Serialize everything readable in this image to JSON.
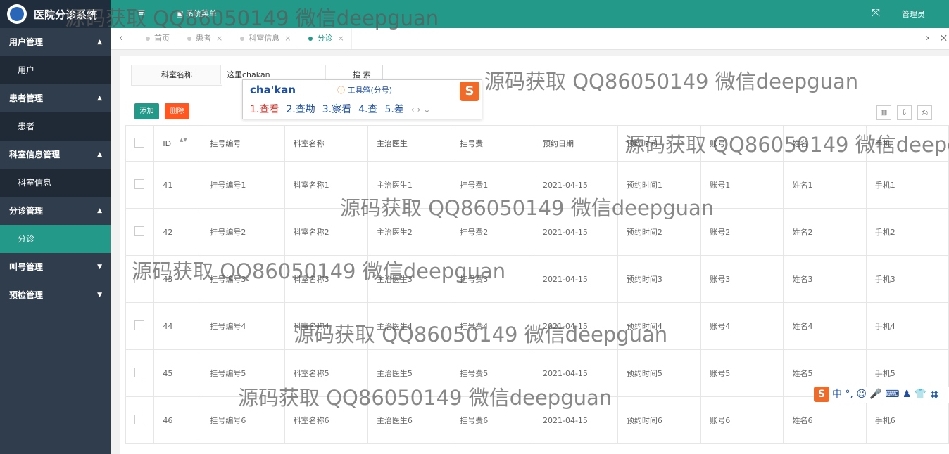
{
  "app": {
    "title": "医院分诊系统",
    "menu_icon": "≡",
    "top_tab": "▣ 系统菜单",
    "fullscreen_icon": "⤧",
    "user": "管理员"
  },
  "sidebar": {
    "groups": [
      {
        "label": "用户管理",
        "arrow": "▲",
        "items": [
          "用户"
        ]
      },
      {
        "label": "患者管理",
        "arrow": "▲",
        "items": [
          "患者"
        ]
      },
      {
        "label": "科室信息管理",
        "arrow": "▲",
        "items": [
          "科室信息"
        ]
      },
      {
        "label": "分诊管理",
        "arrow": "▲",
        "items": [
          "分诊"
        ]
      },
      {
        "label": "叫号管理",
        "arrow": "▼",
        "items": []
      },
      {
        "label": "预检管理",
        "arrow": "▼",
        "items": []
      }
    ]
  },
  "tabs": {
    "prev": "‹",
    "next": "›",
    "close_all": "⨉",
    "items": [
      {
        "label": "首页",
        "close": ""
      },
      {
        "label": "患者",
        "close": "×"
      },
      {
        "label": "科室信息",
        "close": "×"
      },
      {
        "label": "分诊",
        "close": "×"
      }
    ],
    "active_index": 3
  },
  "search": {
    "label": "科室名称",
    "value": "这里chakan",
    "button": "搜 索"
  },
  "toolbar": {
    "add": "添加",
    "delete": "删除",
    "tools": [
      "▥",
      "⇩",
      "⎙"
    ]
  },
  "table": {
    "sort_icon": "▲▼",
    "columns": [
      "ID",
      "挂号编号",
      "科室名称",
      "主治医生",
      "挂号费",
      "预约日期",
      "预约时间",
      "账号",
      "姓名",
      "手机"
    ],
    "rows": [
      [
        "41",
        "挂号编号1",
        "科室名称1",
        "主治医生1",
        "挂号费1",
        "2021-04-15",
        "预约时间1",
        "账号1",
        "姓名1",
        "手机1"
      ],
      [
        "42",
        "挂号编号2",
        "科室名称2",
        "主治医生2",
        "挂号费2",
        "2021-04-15",
        "预约时间2",
        "账号2",
        "姓名2",
        "手机2"
      ],
      [
        "43",
        "挂号编号3",
        "科室名称3",
        "主治医生3",
        "挂号费3",
        "2021-04-15",
        "预约时间3",
        "账号3",
        "姓名3",
        "手机3"
      ],
      [
        "44",
        "挂号编号4",
        "科室名称4",
        "主治医生4",
        "挂号费4",
        "2021-04-15",
        "预约时间4",
        "账号4",
        "姓名4",
        "手机4"
      ],
      [
        "45",
        "挂号编号5",
        "科室名称5",
        "主治医生5",
        "挂号费5",
        "2021-04-15",
        "预约时间5",
        "账号5",
        "姓名5",
        "手机5"
      ],
      [
        "46",
        "挂号编号6",
        "科室名称6",
        "主治医生6",
        "挂号费6",
        "2021-04-15",
        "预约时间6",
        "账号6",
        "姓名6",
        "手机6"
      ]
    ]
  },
  "ime": {
    "composition": "cha'kan",
    "toolbox_icon": "ⓘ",
    "toolbox": "工具箱(分号)",
    "logo": "S",
    "candidates": [
      "1.查看",
      "2.查勘",
      "3.察看",
      "4.查",
      "5.差"
    ],
    "prev": "‹",
    "next": "›",
    "expand": "⌄",
    "status_logo": "S",
    "status_text": "中 °, ☺ 🎤 ⌨ ♟ 👕 ▦"
  },
  "watermark": "源码获取 QQ86050149 微信deepguan",
  "colors": {
    "accent": "#23998a",
    "sidebar": "#2f3d4c",
    "sidebar_sub": "#1f2a36",
    "danger": "#ff5722"
  }
}
